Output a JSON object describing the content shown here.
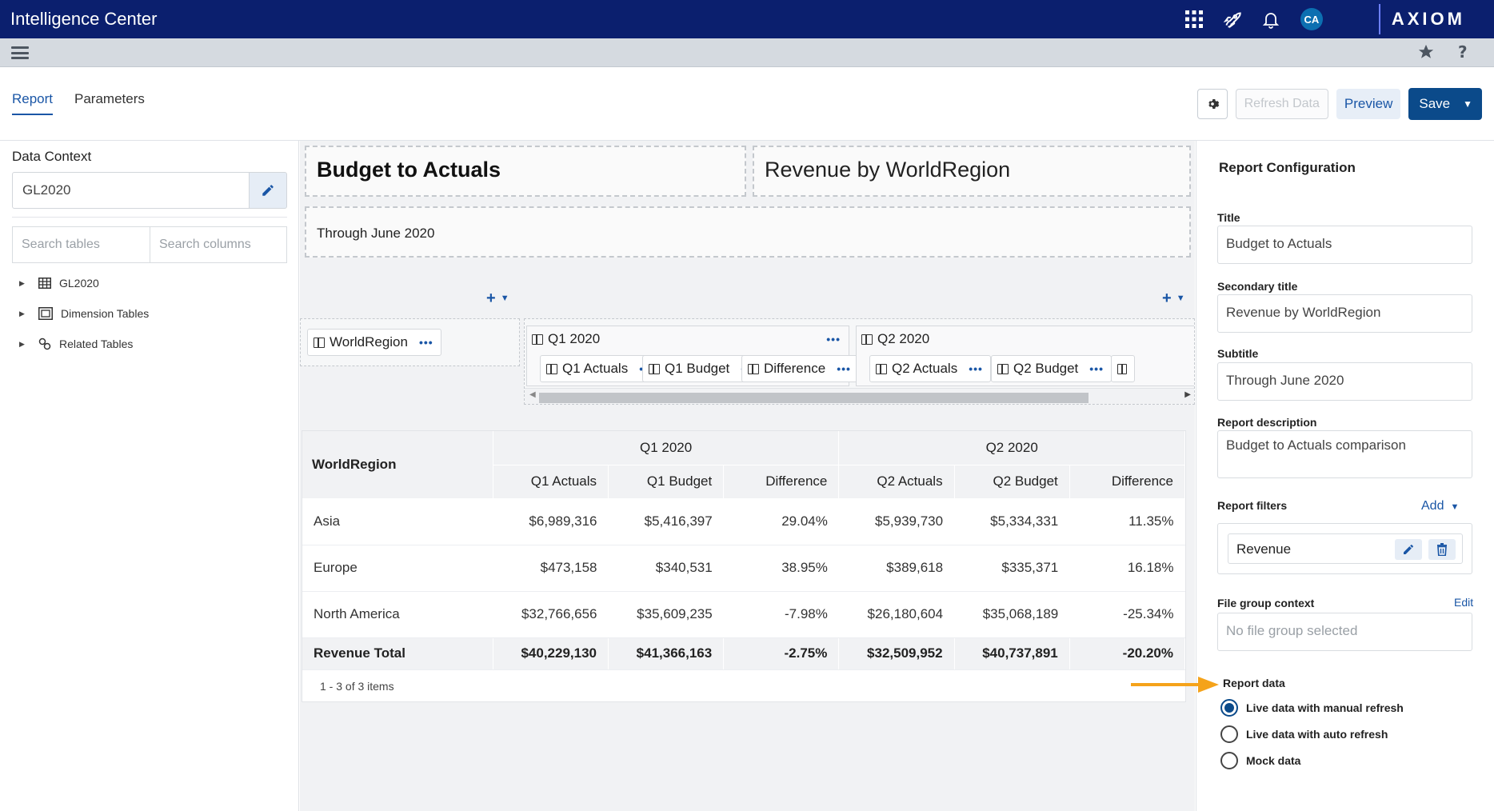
{
  "app": {
    "title": "Intelligence Center",
    "brand": "AXIOM",
    "user_initials": "CA"
  },
  "tabs": [
    {
      "label": "Report"
    },
    {
      "label": "Parameters"
    }
  ],
  "toolbar": {
    "refresh_label": "Refresh Data",
    "preview_label": "Preview",
    "save_label": "Save"
  },
  "data_context": {
    "label": "Data Context",
    "value": "GL2020",
    "search_tables_placeholder": "Search tables",
    "search_columns_placeholder": "Search columns",
    "tree": [
      {
        "label": "GL2020"
      },
      {
        "label": "Dimension Tables"
      },
      {
        "label": "Related Tables"
      }
    ]
  },
  "report": {
    "title": "Budget to Actuals",
    "secondary_title": "Revenue by WorldRegion",
    "subtitle": "Through June 2020"
  },
  "builder": {
    "row_field": "WorldRegion",
    "groups": [
      {
        "label": "Q1 2020",
        "columns": [
          "Q1 Actuals",
          "Q1 Budget",
          "Difference"
        ]
      },
      {
        "label": "Q2 2020",
        "columns": [
          "Q2 Actuals",
          "Q2 Budget"
        ]
      }
    ]
  },
  "grid": {
    "row_header": "WorldRegion",
    "groups": [
      "Q1 2020",
      "Q2 2020"
    ],
    "columns": [
      "Q1 Actuals",
      "Q1 Budget",
      "Difference",
      "Q2 Actuals",
      "Q2 Budget",
      "Difference"
    ],
    "rows": [
      {
        "region": "Asia",
        "cells": [
          "$6,989,316",
          "$5,416,397",
          "29.04%",
          "$5,939,730",
          "$5,334,331",
          "11.35%"
        ]
      },
      {
        "region": "Europe",
        "cells": [
          "$473,158",
          "$340,531",
          "38.95%",
          "$389,618",
          "$335,371",
          "16.18%"
        ]
      },
      {
        "region": "North America",
        "cells": [
          "$32,766,656",
          "$35,609,235",
          "-7.98%",
          "$26,180,604",
          "$35,068,189",
          "-25.34%"
        ]
      }
    ],
    "total": {
      "label": "Revenue Total",
      "cells": [
        "$40,229,130",
        "$41,366,163",
        "-2.75%",
        "$32,509,952",
        "$40,737,891",
        "-20.20%"
      ]
    },
    "footer": "1 - 3 of 3 items"
  },
  "config": {
    "heading": "Report Configuration",
    "title_label": "Title",
    "title_value": "Budget to Actuals",
    "secondary_label": "Secondary title",
    "secondary_value": "Revenue by WorldRegion",
    "subtitle_label": "Subtitle",
    "subtitle_value": "Through June 2020",
    "description_label": "Report description",
    "description_value": "Budget to Actuals comparison",
    "filters_label": "Report filters",
    "filters_add": "Add",
    "filter_item": "Revenue",
    "file_group_label": "File group context",
    "file_group_edit": "Edit",
    "file_group_placeholder": "No file group selected",
    "report_data_label": "Report data",
    "report_data_options": [
      "Live data with manual refresh",
      "Live data with auto refresh",
      "Mock data"
    ]
  },
  "colors": {
    "header": "#0b1f6e",
    "accent": "#1a56a6",
    "save": "#0b4a8a",
    "annotation_arrow": "#f5a31a"
  }
}
